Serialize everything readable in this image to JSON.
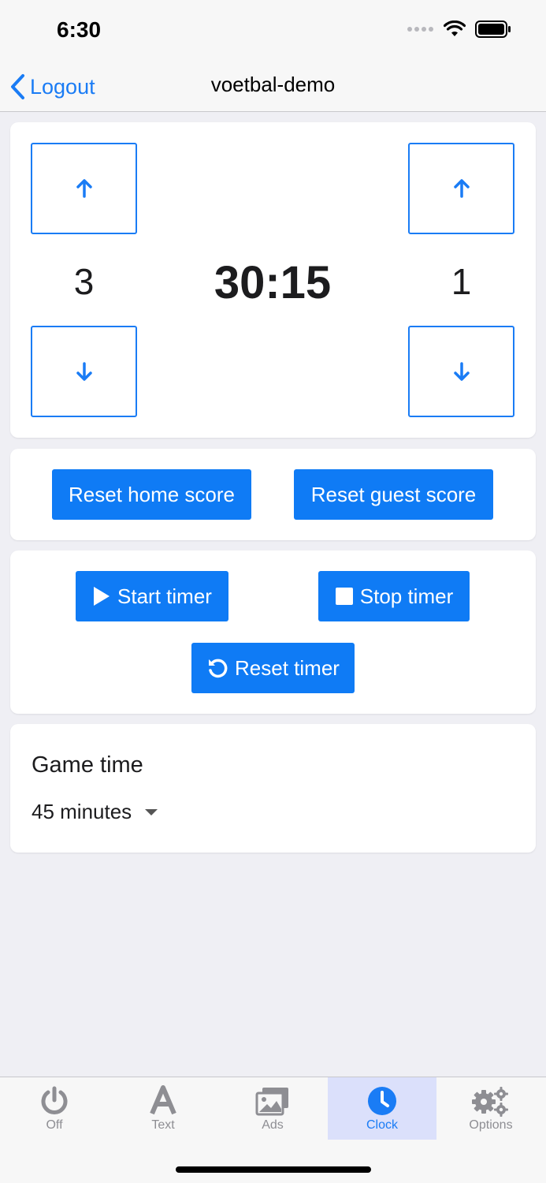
{
  "status_bar": {
    "time": "6:30"
  },
  "nav": {
    "back_label": "Logout",
    "title": "voetbal-demo"
  },
  "scoreboard": {
    "home_score": "3",
    "clock": "30:15",
    "guest_score": "1"
  },
  "reset_scores": {
    "home_label": "Reset home score",
    "guest_label": "Reset guest score"
  },
  "timer": {
    "start_label": "Start timer",
    "stop_label": "Stop timer",
    "reset_label": "Reset timer"
  },
  "game_time": {
    "label": "Game time",
    "selected": "45 minutes"
  },
  "tabs": [
    {
      "label": "Off",
      "icon": "power-icon",
      "active": false
    },
    {
      "label": "Text",
      "icon": "text-icon",
      "active": false
    },
    {
      "label": "Ads",
      "icon": "images-icon",
      "active": false
    },
    {
      "label": "Clock",
      "icon": "clock-icon",
      "active": true
    },
    {
      "label": "Options",
      "icon": "gears-icon",
      "active": false
    }
  ],
  "colors": {
    "accent": "#0f7bf5",
    "active_tab_bg": "#dbe0fb",
    "tab_inactive": "#8e8e93"
  }
}
